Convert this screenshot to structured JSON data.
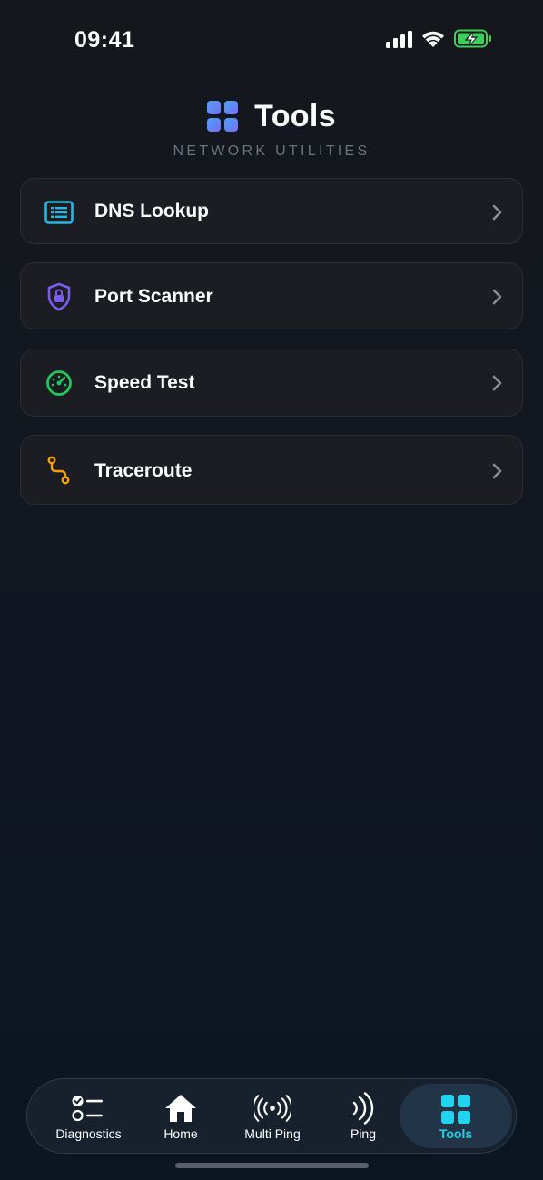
{
  "status_bar": {
    "time": "09:41",
    "icons": [
      "signal-icon",
      "wifi-icon",
      "battery-charging-icon"
    ],
    "battery_color": "#3ecf5a"
  },
  "header": {
    "title": "Tools",
    "subtitle": "NETWORK UTILITIES",
    "icon": "grid-icon"
  },
  "tools": [
    {
      "label": "DNS Lookup",
      "icon": "dns-list-icon",
      "color": "#22b8e6"
    },
    {
      "label": "Port Scanner",
      "icon": "shield-lock-icon",
      "color": "#7c5cf0"
    },
    {
      "label": "Speed Test",
      "icon": "speedometer-icon",
      "color": "#22c55e"
    },
    {
      "label": "Traceroute",
      "icon": "route-icon",
      "color": "#f59e0b"
    }
  ],
  "tab_bar": {
    "items": [
      {
        "label": "Diagnostics",
        "icon": "checklist-icon"
      },
      {
        "label": "Home",
        "icon": "home-icon"
      },
      {
        "label": "Multi Ping",
        "icon": "broadcast-icon"
      },
      {
        "label": "Ping",
        "icon": "signal-waves-icon"
      },
      {
        "label": "Tools",
        "icon": "grid-icon",
        "active": true
      }
    ],
    "accent_color": "#22d3ee"
  }
}
